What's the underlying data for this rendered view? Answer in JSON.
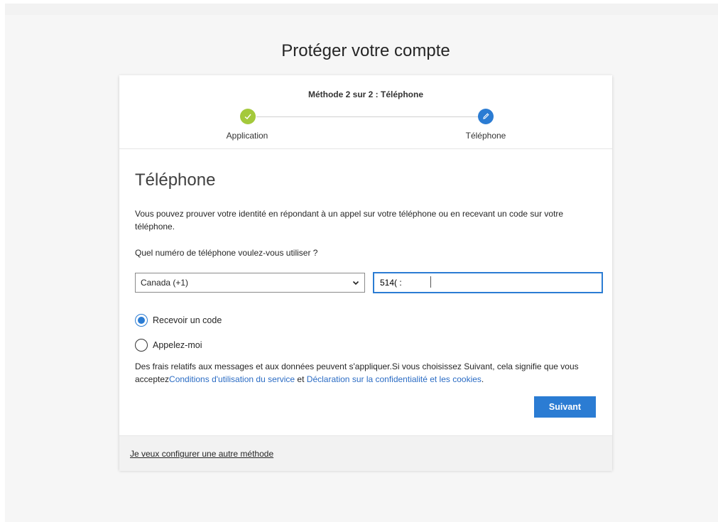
{
  "page": {
    "title": "Protéger votre compte"
  },
  "steps": {
    "method_label": "Méthode 2 sur 2 : Téléphone",
    "items": [
      {
        "label": "Application",
        "state": "done",
        "icon": "checkmark-icon"
      },
      {
        "label": "Téléphone",
        "state": "active",
        "icon": "pencil-icon"
      }
    ]
  },
  "section": {
    "title": "Téléphone",
    "description": "Vous pouvez prouver votre identité en répondant à un appel sur votre téléphone ou en recevant un code sur votre téléphone.",
    "question": "Quel numéro de téléphone voulez-vous utiliser ?"
  },
  "form": {
    "country": "Canada (+1)",
    "phone_value": "514( :",
    "options": [
      {
        "label": "Recevoir un code",
        "checked": true
      },
      {
        "label": "Appelez-moi",
        "checked": false
      }
    ]
  },
  "legal": {
    "text1": "Des frais relatifs aux messages et aux données peuvent s'appliquer.Si vous choisissez Suivant, cela signifie que vous acceptez",
    "terms_link": "Conditions d'utilisation du service",
    "and": " et ",
    "privacy_link": "Déclaration sur la confidentialité et les cookies",
    "end": "."
  },
  "buttons": {
    "next": "Suivant"
  },
  "footer": {
    "other_method_link": "Je veux configurer une autre méthode"
  },
  "colors": {
    "accent": "#2b7cd3",
    "done": "#a4c93b"
  }
}
